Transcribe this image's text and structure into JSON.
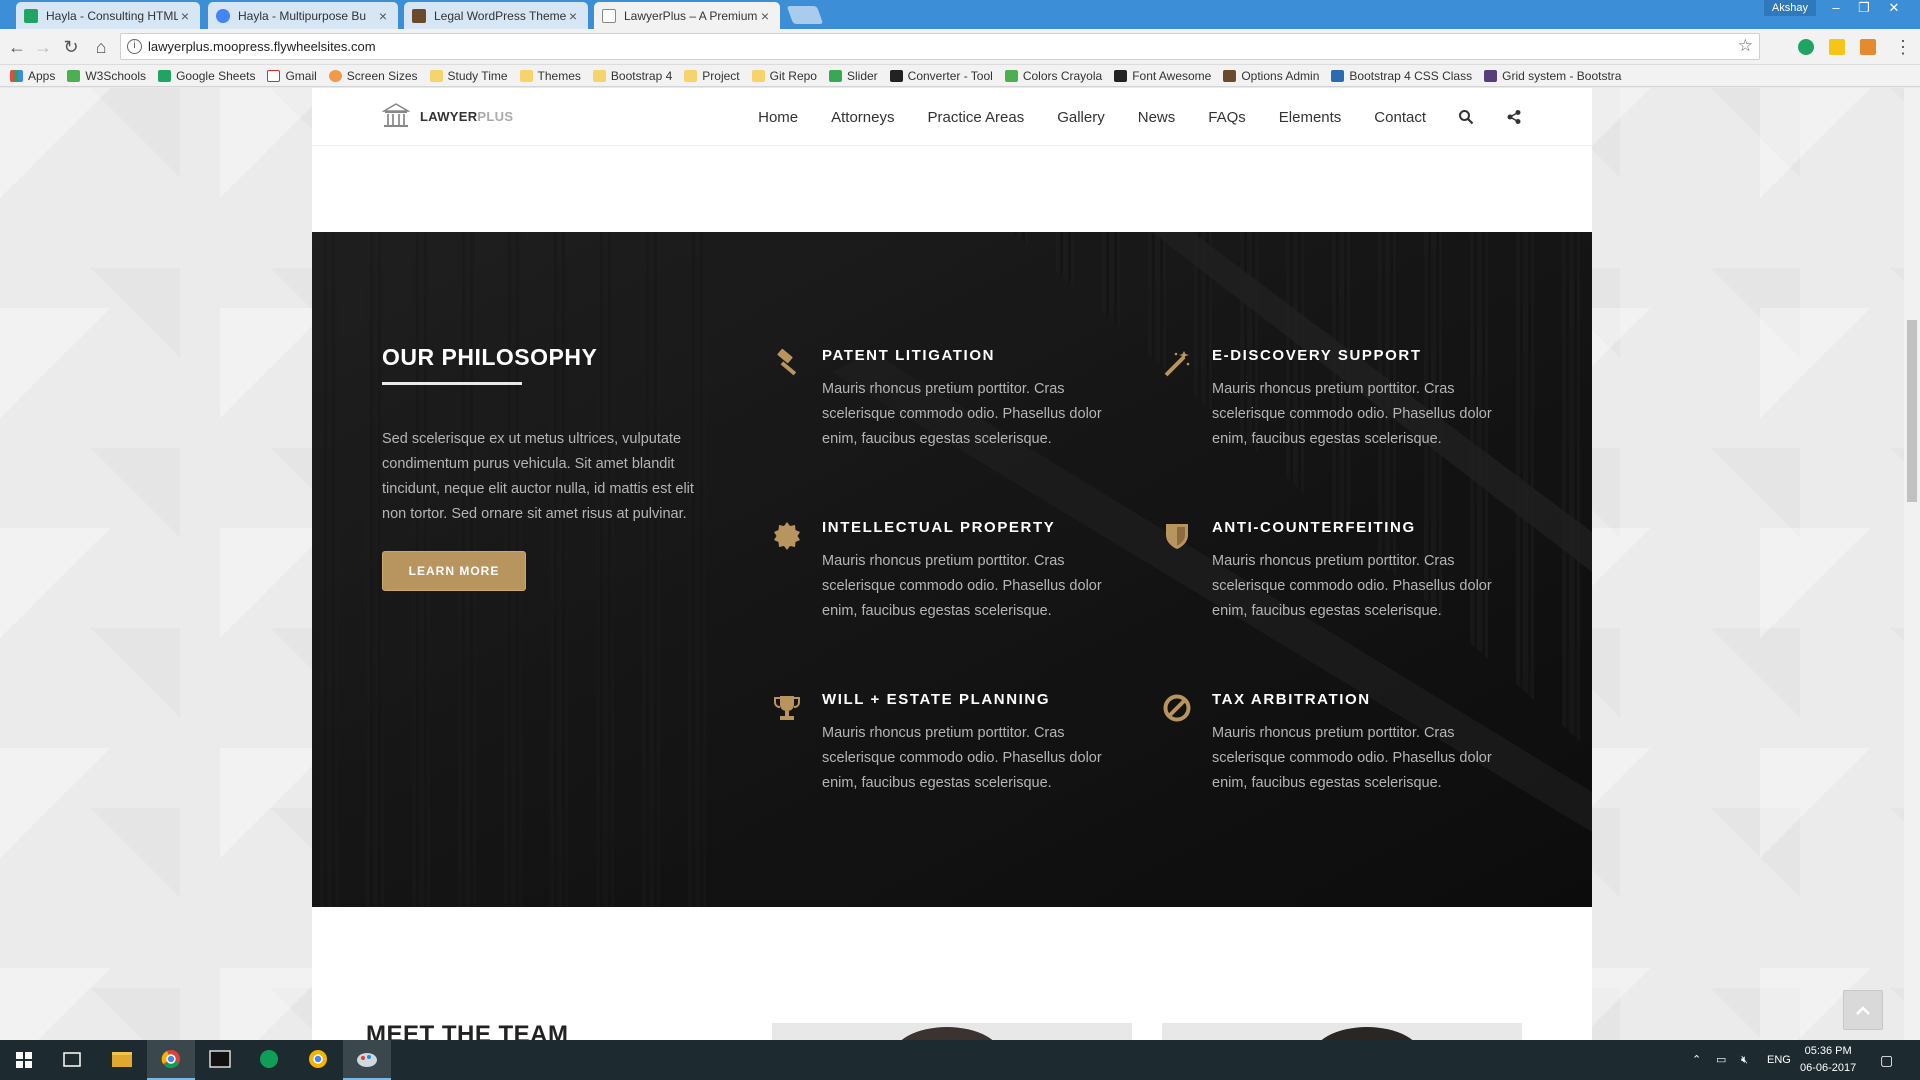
{
  "browser": {
    "tabs": [
      {
        "title": "Hayla - Consulting HTML",
        "icon": "sheets-icon",
        "color": "#1fa463"
      },
      {
        "title": "Hayla - Multipurpose Bu",
        "icon": "chrome-icon",
        "color": "#4285f4"
      },
      {
        "title": "Legal WordPress Themes",
        "icon": "book-icon",
        "color": "#6b4a2b"
      },
      {
        "title": "LawyerPlus – A Premium",
        "icon": "page-icon",
        "color": "#888888"
      }
    ],
    "user": "Akshay",
    "url": "lawyerplus.moopress.flywheelsites.com",
    "bookmarks": [
      {
        "label": "Apps",
        "icon": "apps-icon",
        "color": "#e04a3f"
      },
      {
        "label": "W3Schools",
        "icon": "w3-icon",
        "color": "#4caf50"
      },
      {
        "label": "Google Sheets",
        "icon": "sheets-icon",
        "color": "#1fa463"
      },
      {
        "label": "Gmail",
        "icon": "gmail-icon",
        "color": "#d93025"
      },
      {
        "label": "Screen Sizes",
        "icon": "gear-icon",
        "color": "#f2994a"
      },
      {
        "label": "Study Time",
        "icon": "folder-icon",
        "color": "#f6d36b"
      },
      {
        "label": "Themes",
        "icon": "folder-icon",
        "color": "#f6d36b"
      },
      {
        "label": "Bootstrap 4",
        "icon": "folder-icon",
        "color": "#f6d36b"
      },
      {
        "label": "Project",
        "icon": "folder-icon",
        "color": "#f6d36b"
      },
      {
        "label": "Git Repo",
        "icon": "folder-icon",
        "color": "#f6d36b"
      },
      {
        "label": "Slider",
        "icon": "slider-icon",
        "color": "#3aa757"
      },
      {
        "label": "Converter - Tool",
        "icon": "bt-icon",
        "color": "#222222"
      },
      {
        "label": "Colors Crayola",
        "icon": "w3-icon",
        "color": "#4caf50"
      },
      {
        "label": "Font Awesome",
        "icon": "flag-icon",
        "color": "#222222"
      },
      {
        "label": "Options Admin",
        "icon": "book-icon",
        "color": "#6b4a2b"
      },
      {
        "label": "Bootstrap 4 CSS Class",
        "icon": "arrow-icon",
        "color": "#2b6cb0"
      },
      {
        "label": "Grid system - Bootstra",
        "icon": "bootstrap-icon",
        "color": "#563d7c"
      }
    ]
  },
  "site": {
    "brand_main": "LAWYER",
    "brand_accent": "PLUS",
    "menu": [
      "Home",
      "Attorneys",
      "Practice Areas",
      "Gallery",
      "News",
      "FAQs",
      "Elements",
      "Contact"
    ],
    "accent_color": "#b8945e",
    "philosophy": {
      "title": "OUR PHILOSOPHY",
      "text": "Sed scelerisque ex ut metus ultrices, vulputate condimentum purus vehicula. Sit amet blandit tincidunt, neque elit auctor nulla, id mattis est elit non tortor. Sed ornare sit amet risus at pulvinar.",
      "button": "LEARN MORE"
    },
    "features": [
      {
        "icon": "gavel-icon",
        "title": "PATENT LITIGATION",
        "text": "Mauris rhoncus pretium porttitor. Cras scelerisque commodo odio. Phasellus dolor enim, faucibus egestas scelerisque."
      },
      {
        "icon": "magic-wand-icon",
        "title": "E-DISCOVERY SUPPORT",
        "text": "Mauris rhoncus pretium porttitor. Cras scelerisque commodo odio. Phasellus dolor enim, faucibus egestas scelerisque."
      },
      {
        "icon": "certificate-icon",
        "title": "INTELLECTUAL PROPERTY",
        "text": "Mauris rhoncus pretium porttitor. Cras scelerisque commodo odio. Phasellus dolor enim, faucibus egestas scelerisque."
      },
      {
        "icon": "shield-icon",
        "title": "ANTI-COUNTERFEITING",
        "text": "Mauris rhoncus pretium porttitor. Cras scelerisque commodo odio. Phasellus dolor enim, faucibus egestas scelerisque."
      },
      {
        "icon": "trophy-icon",
        "title": "WILL + ESTATE PLANNING",
        "text": "Mauris rhoncus pretium porttitor. Cras scelerisque commodo odio. Phasellus dolor enim, faucibus egestas scelerisque."
      },
      {
        "icon": "ban-icon",
        "title": "TAX ARBITRATION",
        "text": "Mauris rhoncus pretium porttitor. Cras scelerisque commodo odio. Phasellus dolor enim, faucibus egestas scelerisque."
      }
    ],
    "team_title": "MEET THE TEAM"
  },
  "taskbar": {
    "language": "ENG",
    "time": "05:36 PM",
    "date": "06-06-2017"
  }
}
